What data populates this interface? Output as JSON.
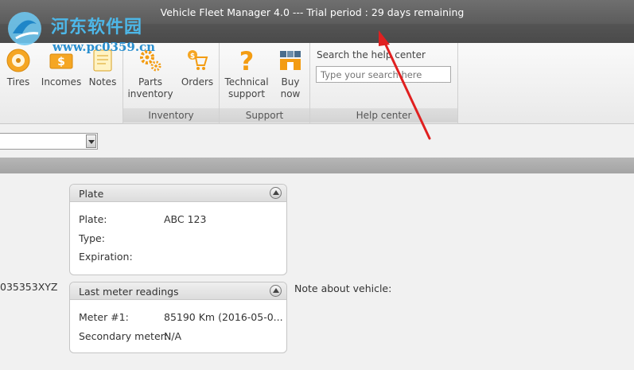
{
  "window": {
    "title": "Vehicle Fleet Manager 4.0 --- Trial period : 29 days remaining"
  },
  "watermark": {
    "title": "河东软件园",
    "url": "www.pc0359.cn"
  },
  "ribbon": {
    "buttons": {
      "tires": {
        "label": "Tires",
        "icon": "tire-icon"
      },
      "incomes": {
        "label": "Incomes",
        "icon": "money-icon"
      },
      "notes": {
        "label": "Notes",
        "icon": "notes-icon"
      },
      "parts_inventory": {
        "label_line1": "Parts",
        "label_line2": "inventory",
        "icon": "gears-icon"
      },
      "orders": {
        "label": "Orders",
        "icon": "cart-icon"
      },
      "technical_support": {
        "label_line1": "Technical",
        "label_line2": "support",
        "icon": "question-icon"
      },
      "buy_now": {
        "label_line1": "Buy",
        "label_line2": "now",
        "icon": "store-icon"
      }
    },
    "groups": {
      "inventory": "Inventory",
      "support": "Support",
      "help_center": "Help center"
    },
    "search": {
      "label": "Search the help center",
      "placeholder": "Type your search here",
      "value": ""
    }
  },
  "vehicle_select": {
    "value": ""
  },
  "vehicle": {
    "vin_partial": "035353XYZ",
    "note_label": "Note about vehicle:"
  },
  "plate_panel": {
    "title": "Plate",
    "plate_label": "Plate:",
    "plate_value": "ABC 123",
    "type_label": "Type:",
    "type_value": "",
    "expiration_label": "Expiration:",
    "expiration_value": ""
  },
  "meter_panel": {
    "title": "Last meter readings",
    "meter1_label": "Meter #1:",
    "meter1_value": "85190 Km (2016-05-0...",
    "secondary_label": "Secondary meter:",
    "secondary_value": "N/A"
  },
  "colors": {
    "titlebar": "#5c5c5c",
    "annotation_arrow": "#e02020",
    "watermark_blue": "#4db7e8",
    "orange_icon": "#f39c12"
  }
}
